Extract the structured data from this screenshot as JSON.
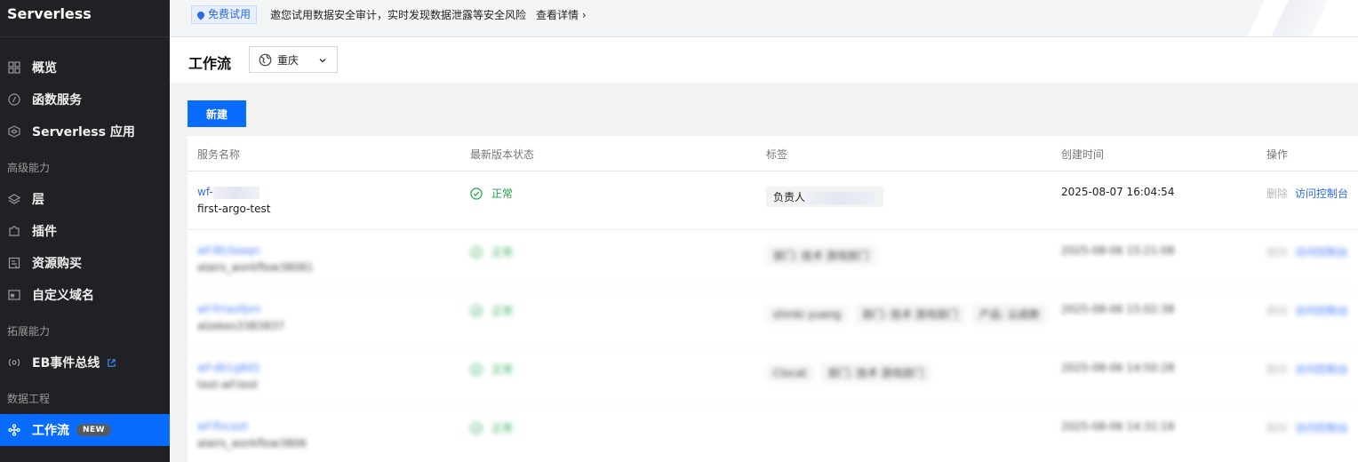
{
  "sidebar": {
    "brand": "Serverless",
    "items": [
      {
        "label": "概览",
        "icon": "grid-icon"
      },
      {
        "label": "函数服务",
        "icon": "function-icon"
      },
      {
        "label": "Serverless 应用",
        "icon": "app-icon"
      }
    ],
    "section_advanced": "高级能力",
    "advanced_items": [
      {
        "label": "层",
        "icon": "layers-icon"
      },
      {
        "label": "插件",
        "icon": "plugin-icon"
      },
      {
        "label": "资源购买",
        "icon": "purchase-icon"
      },
      {
        "label": "自定义域名",
        "icon": "domain-icon"
      }
    ],
    "section_extension": "拓展能力",
    "extension_items": [
      {
        "label": "EB事件总线",
        "icon": "event-bus-icon"
      }
    ],
    "section_data": "数据工程",
    "data_items": [
      {
        "label": "工作流",
        "icon": "workflow-icon",
        "badge": "NEW",
        "active": true
      }
    ]
  },
  "banner": {
    "tag": "免费试用",
    "text": "邀您试用数据安全审计，实时发现数据泄露等安全风险",
    "link": "查看详情 ›"
  },
  "header": {
    "title": "工作流",
    "region": "重庆"
  },
  "toolbar": {
    "new_label": "新建"
  },
  "table": {
    "columns": [
      "服务名称",
      "最新版本状态",
      "标签",
      "创建时间",
      "操作"
    ],
    "rows": [
      {
        "id": "wf-",
        "name": "first-argo-test",
        "status": "正常",
        "tags": [
          "负责人"
        ],
        "created": "2025-08-07 16:04:54",
        "op_delete": "删除",
        "op_console": "访问控制台"
      },
      {
        "id": "wf-8b3aaqn",
        "name": "alairs_workflow38081",
        "status": "正常",
        "tags": [
          "部门: 技术 游戏部门"
        ],
        "created": "2025-08-06 15:21:08",
        "op_delete": "删除",
        "op_console": "访问控制台"
      },
      {
        "id": "wf-frnezfpm",
        "name": "alzekes3383837",
        "status": "正常",
        "tags": [
          "shinki yuang",
          "部门: 技术 游戏部门",
          "产品: 云函数"
        ],
        "created": "2025-08-06 15:02:38",
        "op_delete": "删除",
        "op_console": "访问控制台"
      },
      {
        "id": "wf-db1g8d1",
        "name": "test-wf-test",
        "status": "正常",
        "tags": [
          "Clocat",
          "部门: 技术 游戏部门"
        ],
        "created": "2025-08-06 14:50:28",
        "op_delete": "删除",
        "op_console": "访问控制台"
      },
      {
        "id": "wf-flxcezt",
        "name": "alairs_workflow3806",
        "status": "正常",
        "tags": [],
        "created": "2025-08-06 14:31:18",
        "op_delete": "删除",
        "op_console": "访问控制台"
      }
    ]
  },
  "colors": {
    "primary": "#0a6cff",
    "sidebar_bg": "#202124",
    "success": "#1aa14a",
    "link": "#2b6cf6"
  }
}
